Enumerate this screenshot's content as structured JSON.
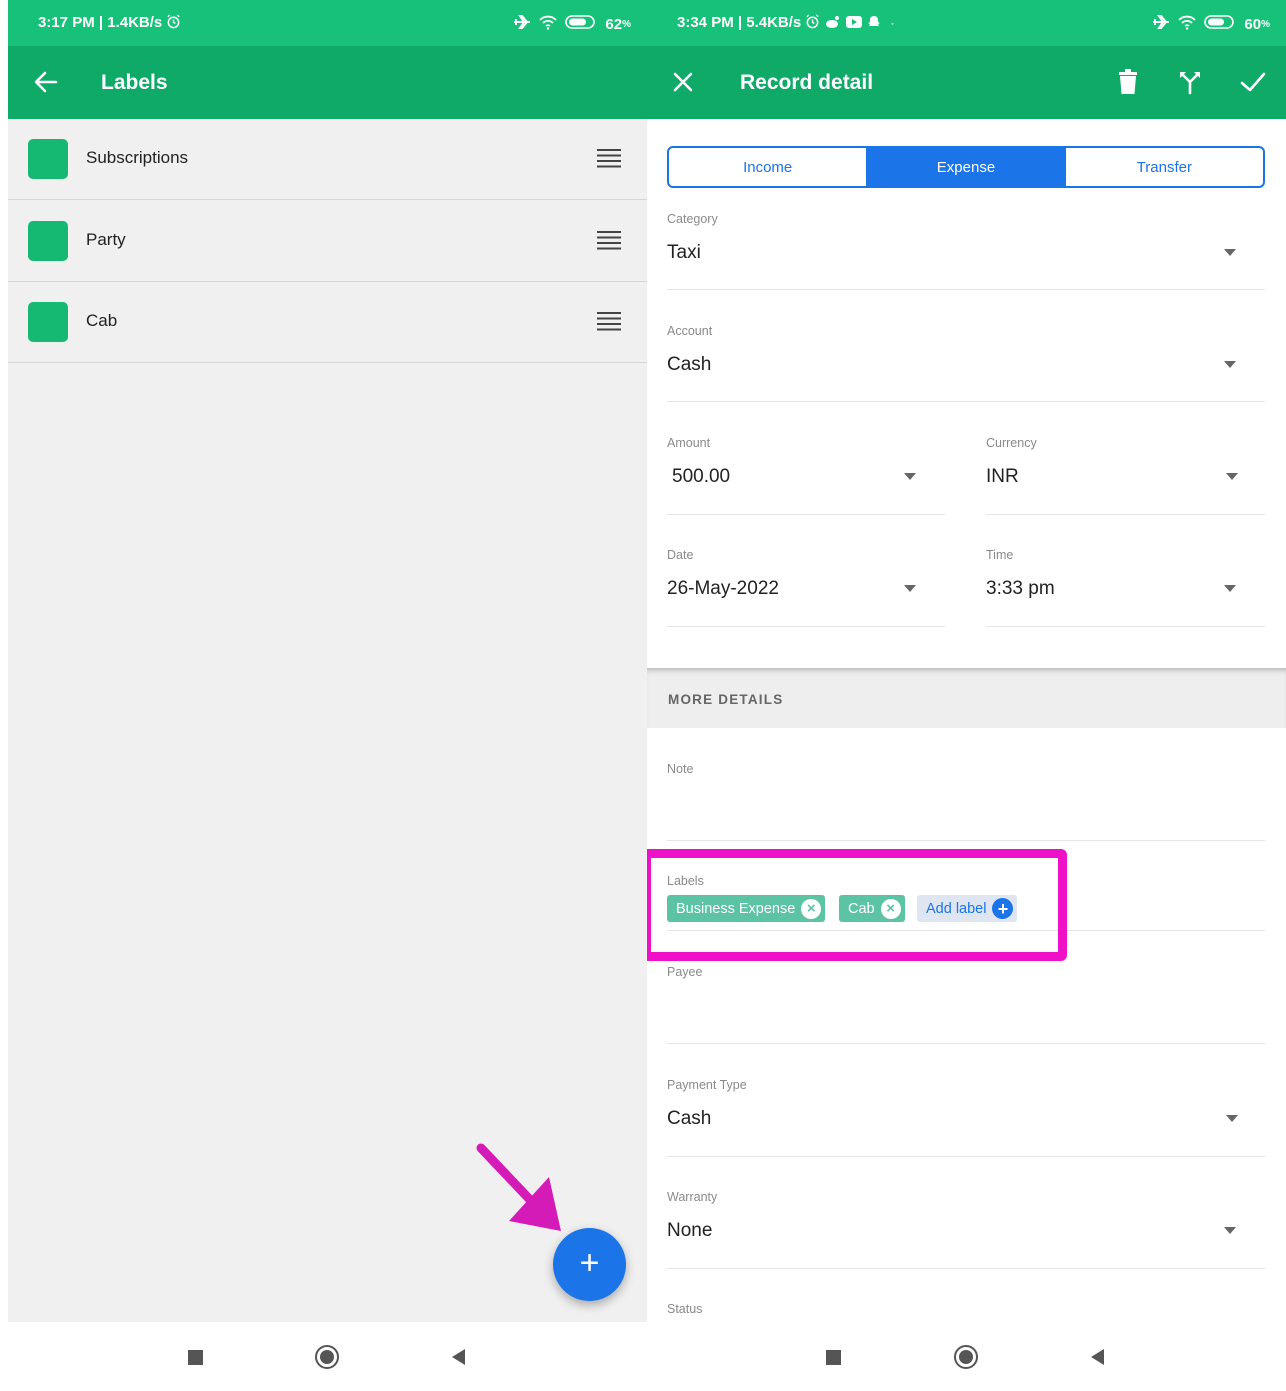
{
  "left": {
    "status": {
      "time_speed": "3:17 PM | 1.4KB/s",
      "battery": "62"
    },
    "toolbar": {
      "title": "Labels"
    },
    "labels": [
      {
        "name": "Subscriptions"
      },
      {
        "name": "Party"
      },
      {
        "name": "Cab"
      }
    ],
    "fab_symbol": "+"
  },
  "right": {
    "status": {
      "time_speed": "3:34 PM | 5.4KB/s",
      "battery": "60"
    },
    "toolbar": {
      "title": "Record detail"
    },
    "tabs": [
      {
        "label": "Income",
        "active": false
      },
      {
        "label": "Expense",
        "active": true
      },
      {
        "label": "Transfer",
        "active": false
      }
    ],
    "form": {
      "category": {
        "label": "Category",
        "value": "Taxi"
      },
      "account": {
        "label": "Account",
        "value": "Cash"
      },
      "amount": {
        "label": "Amount",
        "value": "500.00"
      },
      "currency": {
        "label": "Currency",
        "value": "INR"
      },
      "date": {
        "label": "Date",
        "value": "26-May-2022"
      },
      "time": {
        "label": "Time",
        "value": "3:33 pm"
      }
    },
    "more_details": "MORE DETAILS",
    "note": {
      "label": "Note",
      "value": ""
    },
    "labels_field": {
      "label": "Labels",
      "chips": [
        "Business Expense",
        "Cab"
      ],
      "add_label": "Add label"
    },
    "payee": {
      "label": "Payee",
      "value": ""
    },
    "payment_type": {
      "label": "Payment Type",
      "value": "Cash"
    },
    "warranty": {
      "label": "Warranty",
      "value": "None"
    },
    "status_field": {
      "label": "Status"
    }
  },
  "colors": {
    "status_bar": "#17c179",
    "toolbar": "#0fa968",
    "accent_blue": "#1b74e8",
    "label_green": "#16b972",
    "chip_teal": "#5cc3a5",
    "annotation_magenta": "#ee11c8"
  },
  "icons": [
    "back-arrow-icon",
    "close-icon",
    "trash-icon",
    "split-icon",
    "check-icon",
    "drag-handle-icon",
    "plus-icon",
    "airplane-icon",
    "wifi-icon",
    "battery-icon",
    "alarm-icon",
    "square-nav-icon",
    "circle-nav-icon",
    "back-nav-icon"
  ]
}
